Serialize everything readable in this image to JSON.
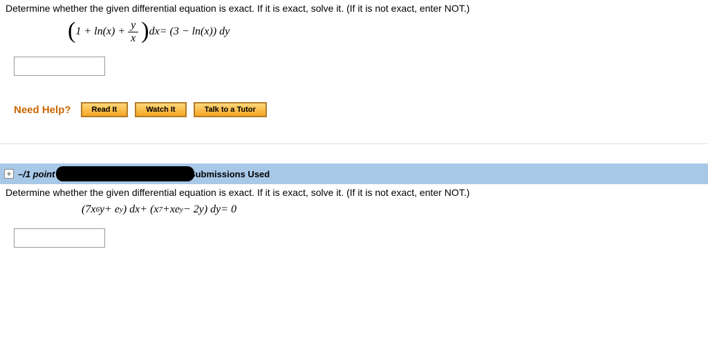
{
  "q1": {
    "prompt": "Determine whether the given differential equation is exact. If it is exact, solve it. (If it is not exact, enter NOT.)",
    "eq_p1": "1 + ln(",
    "eq_x": "x",
    "eq_p2": ") + ",
    "frac_num": "y",
    "frac_den": "x",
    "eq_p3": " d",
    "eq_p3x": "x",
    "eq_p4": " = (3 − ln(",
    "eq_p4x": "x",
    "eq_p5": ")) d",
    "eq_p5y": "y"
  },
  "help": {
    "label": "Need Help?",
    "read": "Read It",
    "watch": "Watch It",
    "tutor": "Talk to a Tutor"
  },
  "q2header": {
    "points": "–/1 point",
    "submissions": "/6 Submissions Used"
  },
  "q2": {
    "prompt": "Determine whether the given differential equation is exact. If it is exact, solve it. (If it is not exact, enter NOT.)",
    "eq_a": "(7",
    "eq_x": "x",
    "eq_sup6": "6",
    "eq_y": "y",
    "eq_b": " + e",
    "eq_supy1": "y",
    "eq_c": ") d",
    "eq_dx": "x",
    "eq_d": " + (",
    "eq_x2": "x",
    "eq_sup7": "7",
    "eq_e": " + ",
    "eq_x3": "x",
    "eq_f": "e",
    "eq_supy2": "y",
    "eq_g": " − 2",
    "eq_y2": "y",
    "eq_h": ") d",
    "eq_dy": "y",
    "eq_i": " = 0"
  }
}
